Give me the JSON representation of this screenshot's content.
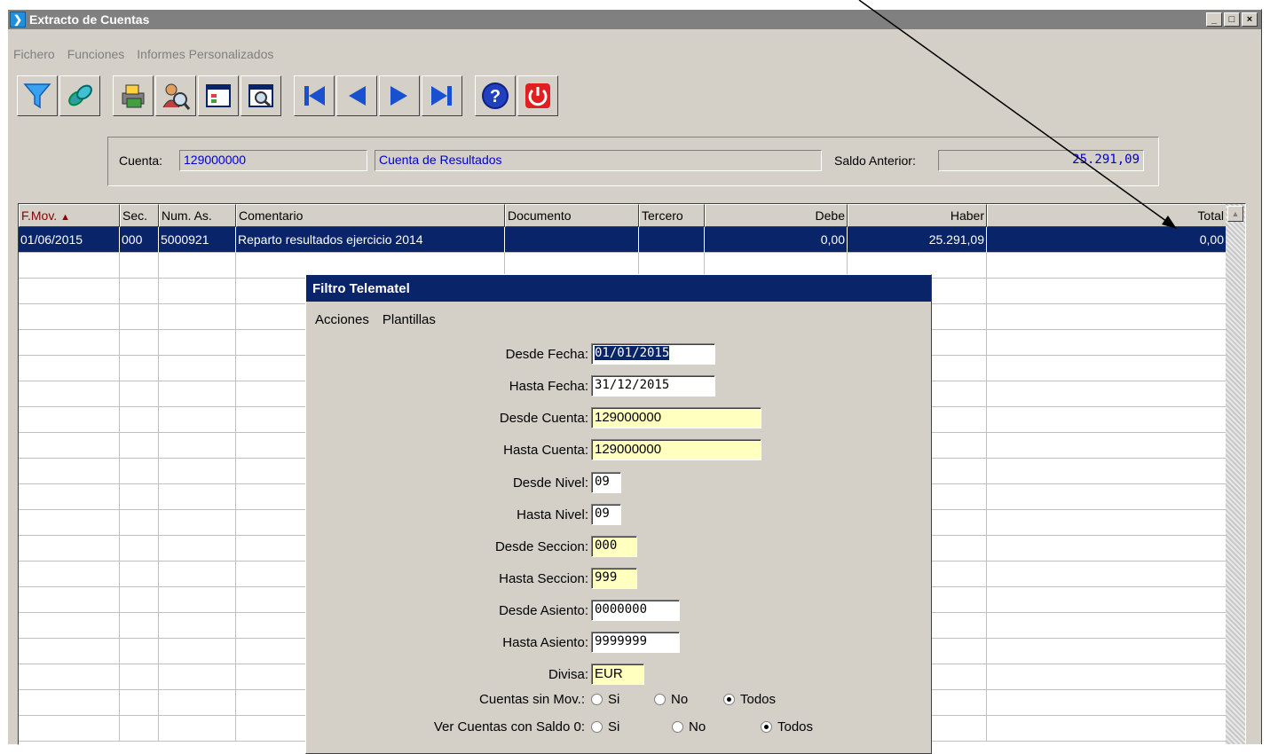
{
  "window": {
    "title": "Extracto de Cuentas",
    "btn_min": "_",
    "btn_max": "□",
    "btn_close": "×"
  },
  "menu": [
    "Fichero",
    "Funciones",
    "Informes Personalizados"
  ],
  "toolbar": [
    "filter-icon",
    "link-icon",
    "print-icon",
    "search-person-icon",
    "window-icon",
    "preview-icon",
    "first-icon",
    "prev-icon",
    "next-icon",
    "last-icon",
    "help-icon",
    "power-icon"
  ],
  "account": {
    "cuenta_label": "Cuenta:",
    "cuenta_value": "129000000",
    "cuenta_name": "Cuenta de Resultados",
    "saldo_label": "Saldo Anterior:",
    "saldo_value": "25.291,09"
  },
  "grid": {
    "columns": [
      "F.Mov.",
      "Sec.",
      "Num. As.",
      "Comentario",
      "Documento",
      "Tercero",
      "Debe",
      "Haber",
      "Total"
    ],
    "sort_indicator": "▲",
    "rows": [
      [
        "01/06/2015",
        "000",
        "5000921",
        "Reparto resultados ejercicio 2014",
        "",
        "",
        "0,00",
        "25.291,09",
        "0,00"
      ]
    ]
  },
  "dialog": {
    "title": "Filtro Telematel",
    "menu": [
      "Acciones",
      "Plantillas"
    ],
    "fields": {
      "desde_fecha": {
        "label": "Desde Fecha:",
        "value": "01/01/2015"
      },
      "hasta_fecha": {
        "label": "Hasta Fecha:",
        "value": "31/12/2015"
      },
      "desde_cuenta": {
        "label": "Desde Cuenta:",
        "value": "129000000"
      },
      "hasta_cuenta": {
        "label": "Hasta Cuenta:",
        "value": "129000000"
      },
      "desde_nivel": {
        "label": "Desde Nivel:",
        "value": "09"
      },
      "hasta_nivel": {
        "label": "Hasta Nivel:",
        "value": "09"
      },
      "desde_seccion": {
        "label": "Desde Seccion:",
        "value": "000"
      },
      "hasta_seccion": {
        "label": "Hasta Seccion:",
        "value": "999"
      },
      "desde_asiento": {
        "label": "Desde Asiento:",
        "value": "0000000"
      },
      "hasta_asiento": {
        "label": "Hasta Asiento:",
        "value": "9999999"
      },
      "divisa": {
        "label": "Divisa:",
        "value": "EUR"
      }
    },
    "cuentas_sin_mov": {
      "label": "Cuentas sin Mov.:",
      "options": [
        "Si",
        "No",
        "Todos"
      ],
      "selected": "Todos"
    },
    "ver_saldo_0": {
      "label": "Ver Cuentas con Saldo 0:",
      "options": [
        "Si",
        "No",
        "Todos"
      ],
      "selected": "Todos"
    }
  }
}
